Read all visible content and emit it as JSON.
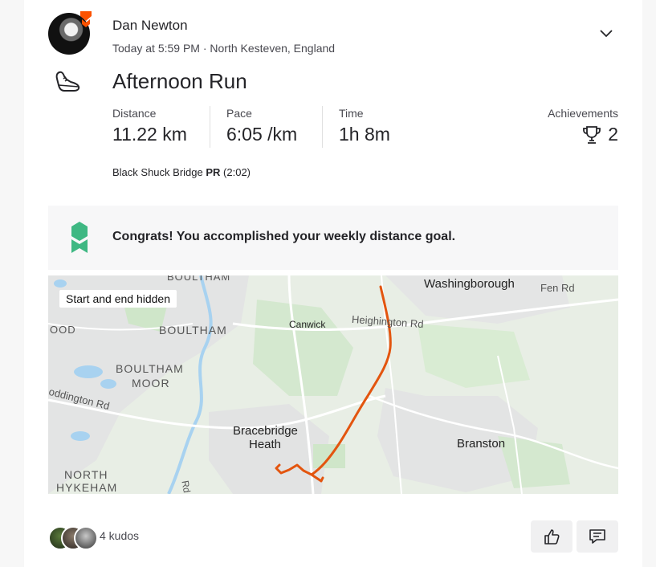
{
  "athlete": {
    "name": "Dan Newton",
    "meta": "Today at 5:59 PM · North Kesteven, England"
  },
  "activity": {
    "title": "Afternoon Run",
    "type_icon": "running-shoe-icon",
    "stats": [
      {
        "label": "Distance",
        "value": "11.22 km"
      },
      {
        "label": "Pace",
        "value": "6:05 /km"
      },
      {
        "label": "Time",
        "value": "1h 8m"
      }
    ],
    "achievements": {
      "label": "Achievements",
      "value": "2",
      "icon": "trophy-icon"
    },
    "segment_pr": {
      "segment": "Black Shuck Bridge",
      "badge": "PR",
      "time": "(2:02)"
    }
  },
  "goal": {
    "text": "Congrats! You accomplished your weekly distance goal.",
    "icon": "goal-ribbon-icon",
    "color": "#3fb883"
  },
  "map": {
    "chip": "Start and end hidden",
    "labels": {
      "boultham_top": "BOULTHAM",
      "washingborough": "Washingborough",
      "fen_rd": "Fen Rd",
      "ood": "OOD",
      "boultham": "BOULTHAM",
      "canwick": "Canwick",
      "heighington_rd": "Heighington Rd",
      "boultham_moor_1": "BOULTHAM",
      "boultham_moor_2": "MOOR",
      "doddington_rd": "oddington Rd",
      "bracebridge_1": "Bracebridge",
      "bracebridge_2": "Heath",
      "branston": "Branston",
      "north": "NORTH",
      "hykeham": "HYKEHAM",
      "rd": "Rd"
    },
    "route_color": "#e3550f"
  },
  "footer": {
    "kudos_text": "4 kudos",
    "like_icon": "thumbs-up-icon",
    "comment_icon": "comment-icon"
  },
  "colors": {
    "brand": "#fc5200",
    "text": "#242428",
    "secondary": "#494950"
  }
}
